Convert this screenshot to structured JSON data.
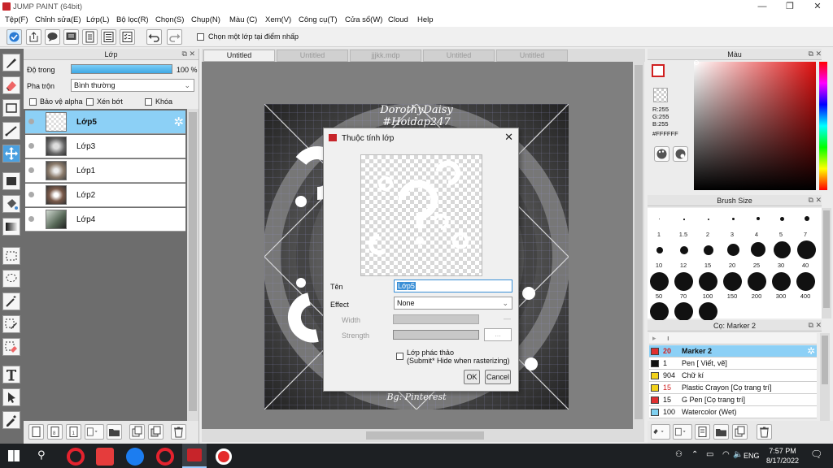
{
  "app": {
    "title": "JUMP PAINT (64bit)"
  },
  "menu": [
    "Tệp(F)",
    "Chỉnh sửa(E)",
    "Lớp(L)",
    "Bộ lọc(R)",
    "Chọn(S)",
    "Chụp(N)",
    "Màu (C)",
    "Xem(V)",
    "Công cụ(T)",
    "Cửa sổ(W)",
    "Cloud",
    "Help"
  ],
  "toolbar": {
    "select_layer_label": "Chọn một lớp tại điểm nhấp"
  },
  "layer_panel": {
    "title": "Lớp",
    "opacity_label": "Độ trong",
    "opacity_value": "100 %",
    "blend_label": "Pha trộn",
    "blend_value": "Bình thường",
    "protect_alpha": "Bảo vệ alpha",
    "clip": "Xén bớt",
    "lock": "Khóa",
    "layers": [
      {
        "name": "Lớp5",
        "selected": true
      },
      {
        "name": "Lớp3",
        "selected": false
      },
      {
        "name": "Lớp1",
        "selected": false
      },
      {
        "name": "Lớp2",
        "selected": false
      },
      {
        "name": "Lớp4",
        "selected": false
      }
    ]
  },
  "tabs": [
    {
      "label": "Untitled",
      "active": true
    },
    {
      "label": "Untitled",
      "active": false
    },
    {
      "label": "jjjkk.mdp",
      "active": false
    },
    {
      "label": "Untitled",
      "active": false
    },
    {
      "label": "Untitled",
      "active": false
    }
  ],
  "artwork": {
    "watermark_top_1": "DorothyDaisy",
    "watermark_top_2": "#Hoidap247",
    "watermark_bottom": "Bg: Pinterest"
  },
  "color_panel": {
    "title": "Màu",
    "r": "R:255",
    "g": "G:255",
    "b": "B:255",
    "hex": "#FFFFFF"
  },
  "brush_panel": {
    "title": "Brush Size",
    "sizes": [
      "1",
      "1.5",
      "2",
      "3",
      "4",
      "5",
      "7",
      "10",
      "12",
      "15",
      "20",
      "25",
      "30",
      "40",
      "50",
      "70",
      "100",
      "150",
      "200",
      "300",
      "400"
    ]
  },
  "marker_panel": {
    "title": "Cọ: Marker 2",
    "items": [
      {
        "size": "20",
        "name": "Marker 2",
        "color": "#e03030",
        "selected": true
      },
      {
        "size": "1",
        "name": "Pen [ Viết, vẽ]",
        "color": "#111111",
        "selected": false
      },
      {
        "size": "904",
        "name": "Chữ kí",
        "color": "#f2d21a",
        "selected": false
      },
      {
        "size": "15",
        "name": "Plastic Crayon [Cọ trang trí]",
        "color": "#f2d21a",
        "selected": false
      },
      {
        "size": "15",
        "name": "G Pen [Cọ trang trí]",
        "color": "#e03030",
        "selected": false
      },
      {
        "size": "100",
        "name": "Watercolor (Wet)",
        "color": "#7fd0f0",
        "selected": false
      }
    ]
  },
  "dialog": {
    "title": "Thuộc tính lớp",
    "name_label": "Tên",
    "name_value": "Lớp5",
    "effect_label": "Effect",
    "effect_value": "None",
    "width_label": "Width",
    "strength_label": "Strength",
    "draft_label": "Lớp phác thảo",
    "draft_note": "(Submit* Hide when rasterizing)",
    "ok": "OK",
    "cancel": "Cancel"
  },
  "taskbar": {
    "time": "7:57 PM",
    "date": "8/17/2022",
    "lang": "ENG"
  }
}
